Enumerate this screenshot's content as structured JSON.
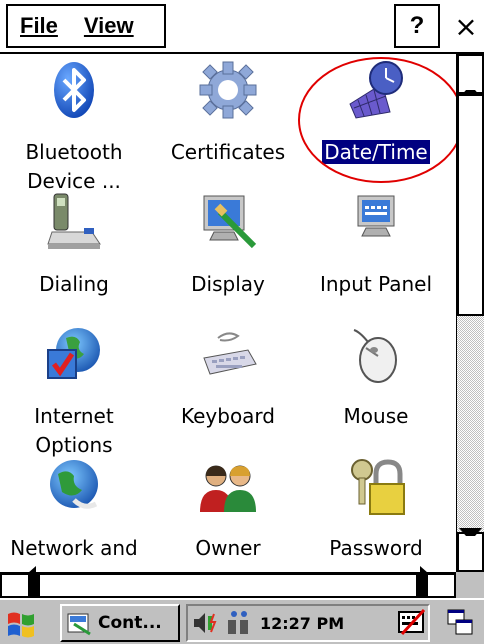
{
  "menu": {
    "file": "File",
    "view": "View",
    "help": "?",
    "close": "×"
  },
  "items": [
    {
      "id": "bluetooth",
      "line1": "Bluetooth",
      "line2": "Device ...",
      "icon": "bluetooth-icon"
    },
    {
      "id": "certificates",
      "line1": "Certificates",
      "line2": "",
      "icon": "certificates-icon"
    },
    {
      "id": "datetime",
      "line1": "Date/Time",
      "line2": "",
      "icon": "date-time-icon",
      "selected": true
    },
    {
      "id": "dialing",
      "line1": "Dialing",
      "line2": "",
      "icon": "dialing-icon"
    },
    {
      "id": "display",
      "line1": "Display",
      "line2": "",
      "icon": "display-icon"
    },
    {
      "id": "inputpanel",
      "line1": "Input Panel",
      "line2": "",
      "icon": "input-panel-icon"
    },
    {
      "id": "internet",
      "line1": "Internet",
      "line2": "Options",
      "icon": "internet-options-icon"
    },
    {
      "id": "keyboard",
      "line1": "Keyboard",
      "line2": "",
      "icon": "keyboard-icon"
    },
    {
      "id": "mouse",
      "line1": "Mouse",
      "line2": "",
      "icon": "mouse-icon"
    },
    {
      "id": "network",
      "line1": "Network and",
      "line2": "",
      "icon": "network-icon"
    },
    {
      "id": "owner",
      "line1": "Owner",
      "line2": "",
      "icon": "owner-icon"
    },
    {
      "id": "password",
      "line1": "Password",
      "line2": "",
      "icon": "password-icon"
    }
  ],
  "taskbar": {
    "task_label": "Cont...",
    "clock": "12:27 PM"
  },
  "colors": {
    "selection": "#000080",
    "annotation": "#e00000",
    "chrome": "#c0c0c0"
  }
}
